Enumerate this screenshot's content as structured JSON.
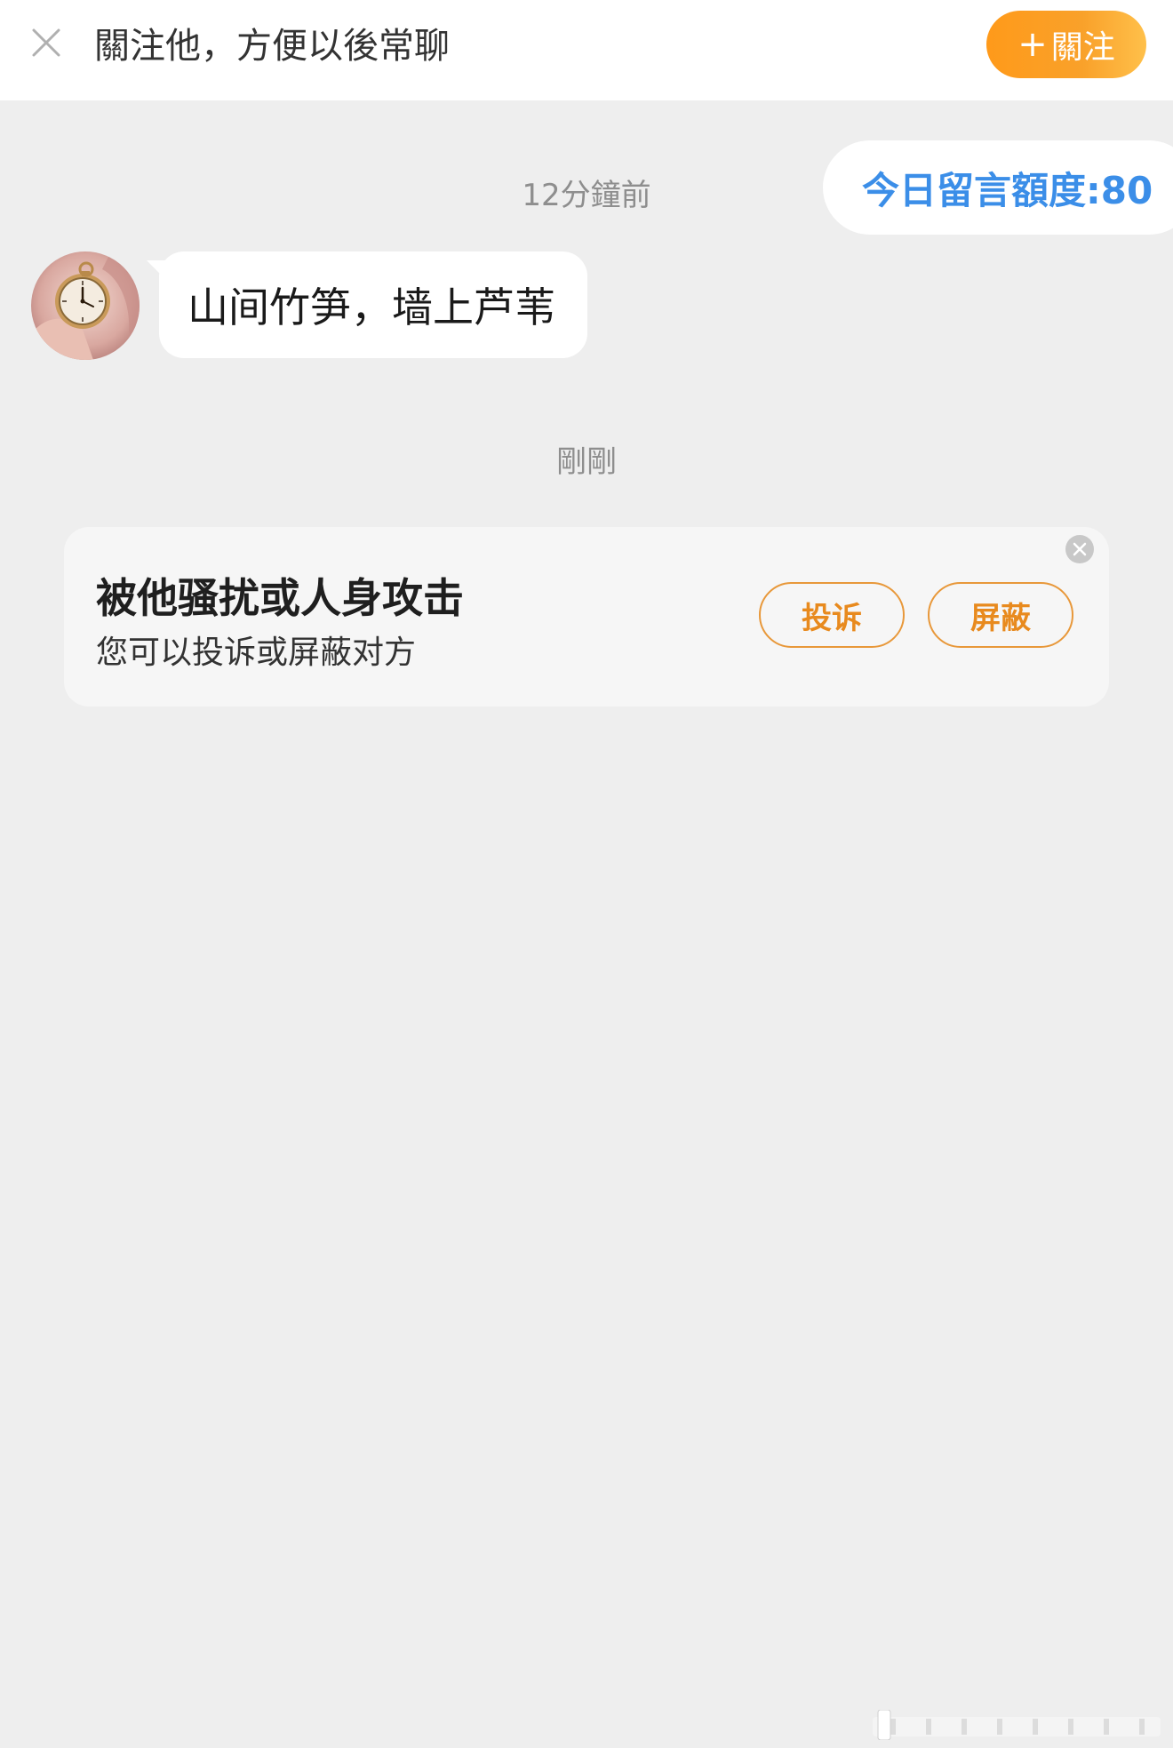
{
  "topbar": {
    "close_icon": "close-icon",
    "prompt_text": "關注他，方便以後常聊",
    "follow_button_plus": "+",
    "follow_button_label": "關注",
    "follow_button_color": "#ff9a1a"
  },
  "quota": {
    "label": "今日留言額度:80",
    "color": "#3b8ee8"
  },
  "conversation": {
    "timestamps": [
      "12分鐘前",
      "剛剛"
    ],
    "messages": [
      {
        "sender": "other",
        "avatar": "pocket-watch-avatar",
        "text": "山间竹笋，墙上芦苇"
      }
    ]
  },
  "safety_card": {
    "title": "被他骚扰或人身攻击",
    "subtitle": "您可以投诉或屏蔽对方",
    "report_button": "投诉",
    "block_button": "屏蔽",
    "accent_color": "#e88a1e",
    "close_icon": "close-circle-icon"
  }
}
